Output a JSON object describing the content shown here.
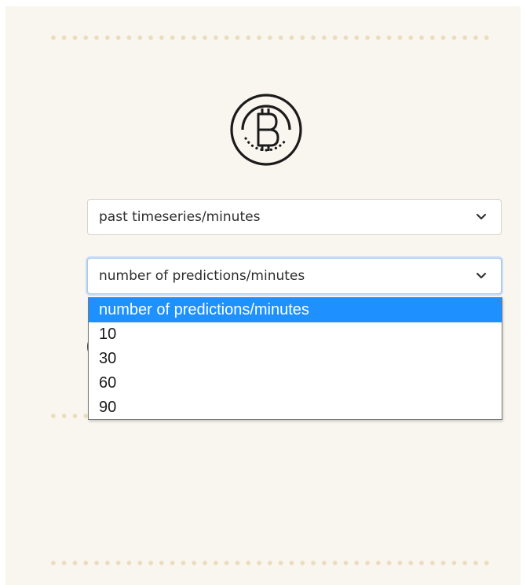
{
  "decorations": {
    "dot_color": "#ecdcbd",
    "panel_background": "#f9f6ef"
  },
  "logo": {
    "icon": "bitcoin-coin-icon"
  },
  "past_timeseries_select": {
    "selected_label": "past timeseries/minutes",
    "icon": "chevron-down-icon"
  },
  "predictions_select": {
    "selected_label": "number of predictions/minutes",
    "icon": "chevron-down-icon",
    "focused": true,
    "expanded": true,
    "options": [
      {
        "label": "number of predictions/minutes",
        "highlighted": true
      },
      {
        "label": "10"
      },
      {
        "label": "30"
      },
      {
        "label": "60"
      },
      {
        "label": "90"
      }
    ],
    "highlight_color": "#1e90ff"
  }
}
